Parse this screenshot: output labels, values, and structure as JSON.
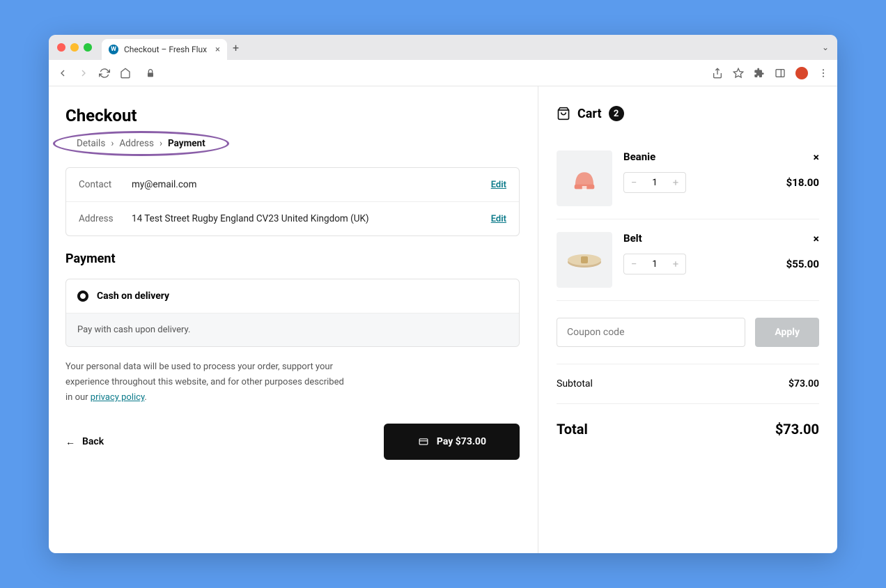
{
  "browser": {
    "tab_title": "Checkout – Fresh Flux"
  },
  "page": {
    "title": "Checkout",
    "breadcrumbs": {
      "step1": "Details",
      "step2": "Address",
      "step3": "Payment"
    },
    "info": {
      "contact_label": "Contact",
      "contact_value": "my@email.com",
      "address_label": "Address",
      "address_value": "14 Test Street Rugby England CV23 United Kingdom (UK)",
      "edit": "Edit"
    },
    "payment": {
      "heading": "Payment",
      "option": "Cash on delivery",
      "description": "Pay with cash upon delivery."
    },
    "privacy": {
      "text_a": "Your personal data will be used to process your order, support your experience throughout this website, and for other purposes described in our ",
      "link": "privacy policy",
      "text_b": "."
    },
    "back_label": "Back",
    "pay_label": "Pay $73.00"
  },
  "cart": {
    "title": "Cart",
    "count": "2",
    "items": [
      {
        "name": "Beanie",
        "qty": "1",
        "price": "$18.00"
      },
      {
        "name": "Belt",
        "qty": "1",
        "price": "$55.00"
      }
    ],
    "coupon_placeholder": "Coupon code",
    "apply": "Apply",
    "subtotal_label": "Subtotal",
    "subtotal_value": "$73.00",
    "total_label": "Total",
    "total_value": "$73.00"
  }
}
